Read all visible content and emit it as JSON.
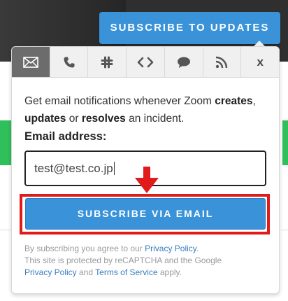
{
  "header": {
    "subscribe_updates_label": "SUBSCRIBE TO UPDATES"
  },
  "tabs": [
    {
      "name": "email",
      "icon": "envelope-icon",
      "active": true
    },
    {
      "name": "sms",
      "icon": "phone-icon"
    },
    {
      "name": "slack",
      "icon": "slack-icon"
    },
    {
      "name": "webhook",
      "icon": "code-icon"
    },
    {
      "name": "chat",
      "icon": "speech-bubble-icon"
    },
    {
      "name": "rss",
      "icon": "rss-icon"
    },
    {
      "name": "close",
      "label": "x"
    }
  ],
  "form": {
    "desc_prefix": "Get email notifications whenever Zoom ",
    "desc_creates": "creates",
    "desc_comma": ", ",
    "desc_updates": "updates",
    "desc_or": " or ",
    "desc_resolves": "resolves",
    "desc_suffix": " an incident.",
    "email_label": "Email address:",
    "email_value": "test@test.co.jp",
    "subscribe_label": "SUBSCRIBE VIA EMAIL"
  },
  "legal": {
    "line1_prefix": "By subscribing you agree to our ",
    "privacy_policy": "Privacy Policy",
    "line1_suffix": ".",
    "line2": "This site is protected by reCAPTCHA and the Google",
    "google_privacy": "Privacy Policy",
    "and": " and ",
    "terms": "Terms of Service",
    "apply": " apply."
  },
  "colors": {
    "accent_blue": "#3a93d8",
    "annotation_red": "#e11a1a",
    "banner_green": "#2fbf5b"
  }
}
